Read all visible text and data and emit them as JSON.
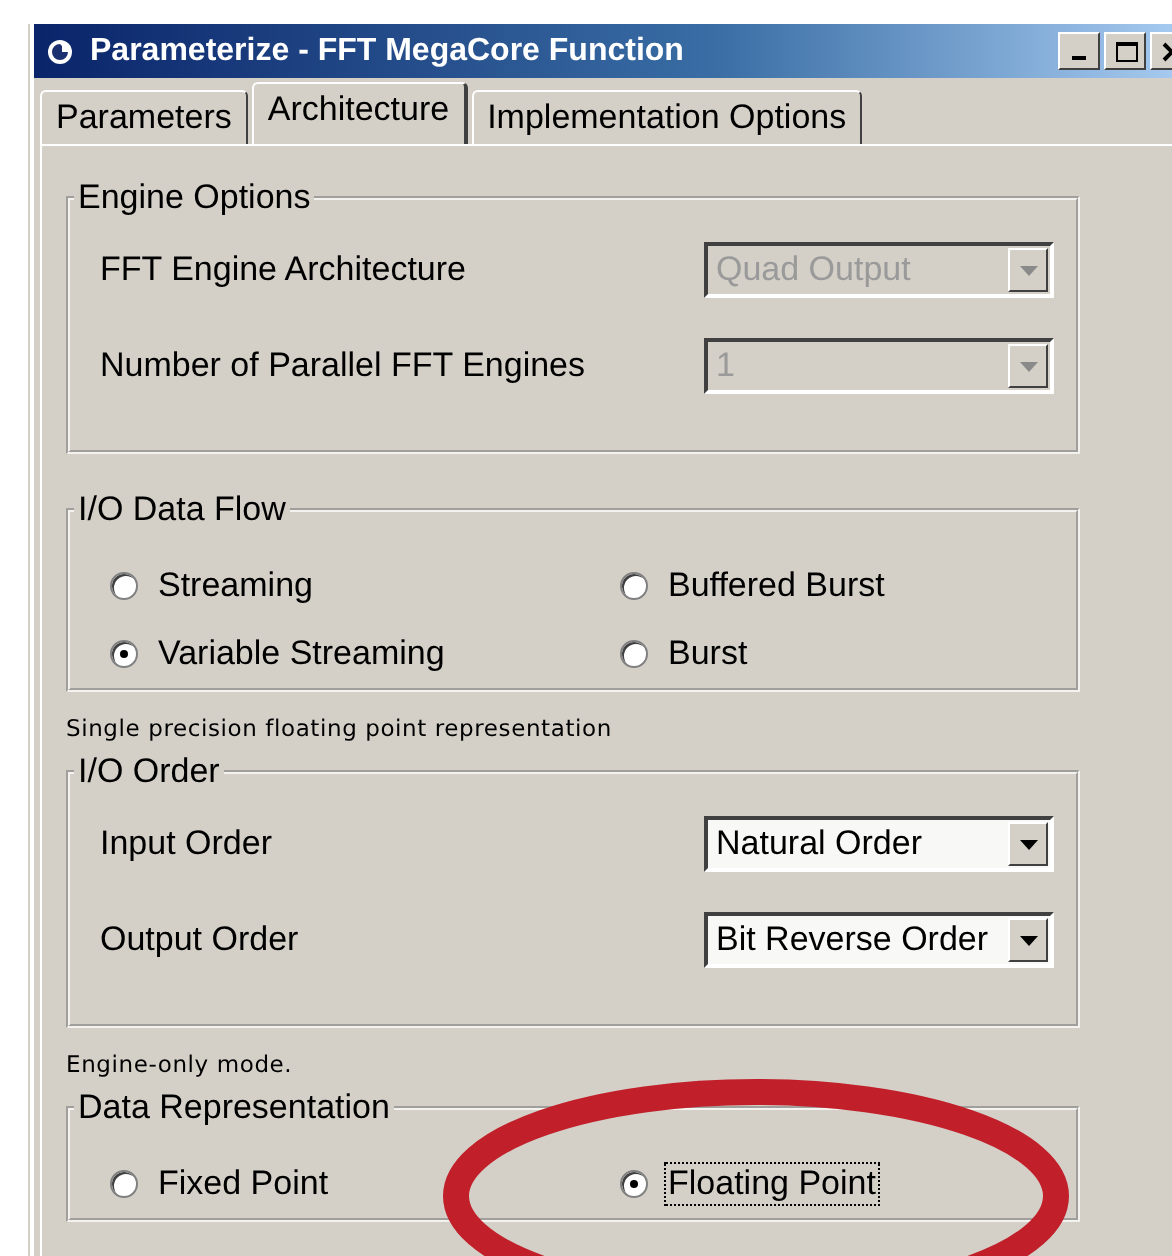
{
  "window": {
    "title": "Parameterize - FFT MegaCore Function",
    "controls": [
      {
        "kind": "minimize"
      },
      {
        "kind": "maximize"
      },
      {
        "kind": "close"
      }
    ]
  },
  "tabs": [
    {
      "label": "Parameters",
      "selected": false
    },
    {
      "label": "Architecture",
      "selected": true
    },
    {
      "label": "Implementation Options",
      "selected": false
    }
  ],
  "sections": [
    {
      "kind": "dropdowns",
      "title": "Engine Options",
      "rows": [
        {
          "label": "FFT Engine Architecture",
          "value": "Quad Output",
          "disabled": true
        },
        {
          "label": "Number of Parallel FFT Engines",
          "value": "1",
          "disabled": true
        }
      ]
    },
    {
      "kind": "radios",
      "title": "I/O Data Flow",
      "options": [
        {
          "label": "Streaming",
          "selected": false,
          "focused": false
        },
        {
          "label": "Buffered Burst",
          "selected": false,
          "focused": false
        },
        {
          "label": "Variable Streaming",
          "selected": true,
          "focused": false
        },
        {
          "label": "Burst",
          "selected": false,
          "focused": false
        }
      ]
    },
    {
      "kind": "note",
      "text": "Single precision floating point representation"
    },
    {
      "kind": "dropdowns",
      "title": "I/O Order",
      "rows": [
        {
          "label": "Input Order",
          "value": "Natural Order",
          "disabled": false
        },
        {
          "label": "Output Order",
          "value": "Bit Reverse Order",
          "disabled": false
        }
      ]
    },
    {
      "kind": "note",
      "text": "Engine-only mode."
    },
    {
      "kind": "radios",
      "title": "Data Representation",
      "options": [
        {
          "label": "Fixed Point",
          "selected": false,
          "focused": false
        },
        {
          "label": "Floating Point",
          "selected": true,
          "focused": true
        }
      ]
    }
  ],
  "annotation": {
    "kind": "ellipse"
  }
}
